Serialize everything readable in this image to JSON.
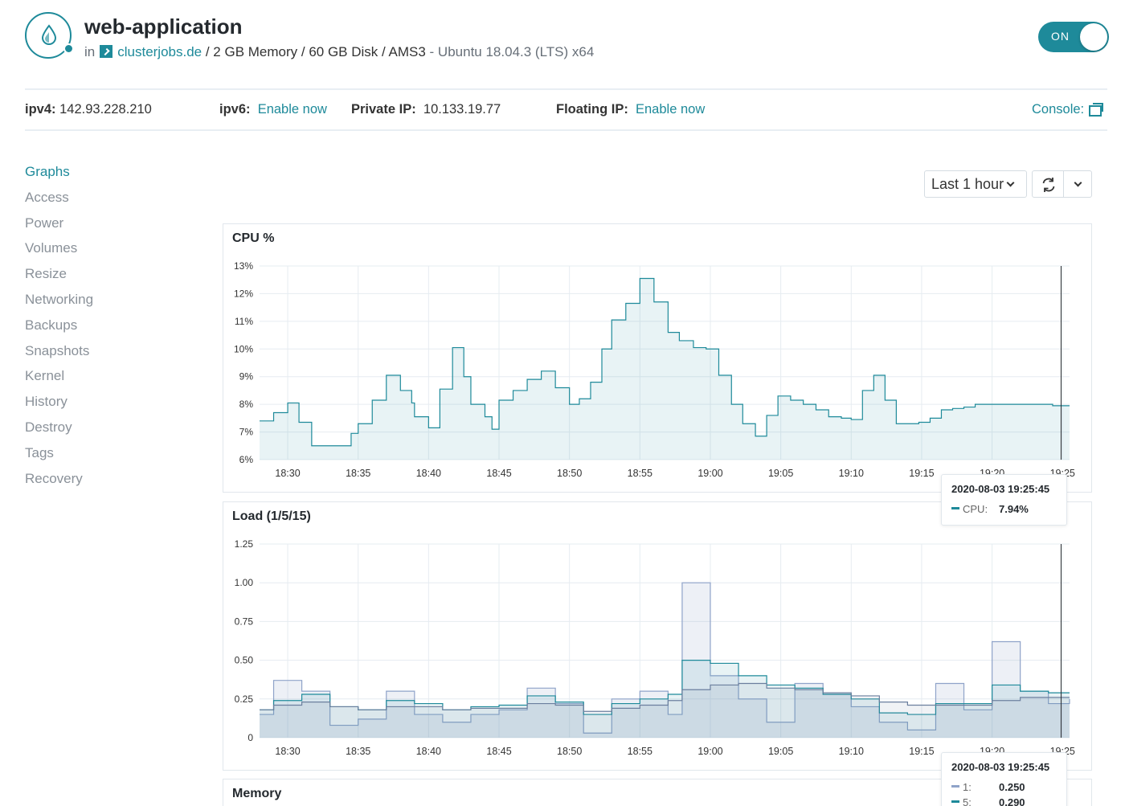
{
  "header": {
    "title": "web-application",
    "in_label": "in",
    "project_name": "clusterjobs.de",
    "specs": " / 2 GB Memory / 60 GB Disk / AMS3",
    "os": " - Ubuntu 18.04.3 (LTS) x64",
    "power_toggle_label": "ON",
    "accent_color": "#1e8a9a"
  },
  "ips": {
    "ipv4_label": "ipv4:",
    "ipv4_value": "142.93.228.210",
    "ipv6_label": "ipv6:",
    "ipv6_link": "Enable now",
    "private_label": "Private IP:",
    "private_value": "10.133.19.77",
    "floating_label": "Floating IP:",
    "floating_link": "Enable now",
    "console_label": "Console:"
  },
  "sidebar": {
    "items": [
      {
        "label": "Graphs",
        "active": true
      },
      {
        "label": "Access"
      },
      {
        "label": "Power"
      },
      {
        "label": "Volumes"
      },
      {
        "label": "Resize"
      },
      {
        "label": "Networking"
      },
      {
        "label": "Backups"
      },
      {
        "label": "Snapshots"
      },
      {
        "label": "Kernel"
      },
      {
        "label": "History"
      },
      {
        "label": "Destroy"
      },
      {
        "label": "Tags"
      },
      {
        "label": "Recovery"
      }
    ]
  },
  "toolbar": {
    "range_label": "Last 1 hour",
    "refresh_icon": "refresh-icon",
    "more_icon": "chevron-down-icon"
  },
  "chart_data": [
    {
      "type": "area",
      "title": "CPU %",
      "x_ticks": [
        "18:30",
        "18:35",
        "18:40",
        "18:45",
        "18:50",
        "18:55",
        "19:00",
        "19:05",
        "19:10",
        "19:15",
        "19:20",
        "19:25"
      ],
      "y_ticks": [
        "6%",
        "7%",
        "8%",
        "9%",
        "10%",
        "11%",
        "12%",
        "13%"
      ],
      "ylim": [
        6,
        13
      ],
      "x_start_min": 28.0,
      "x_end_min": 85.5,
      "grid": true,
      "cursor_min": 84.9,
      "series": [
        {
          "name": "CPU",
          "color": "#1e8a9a",
          "x": [
            28.0,
            29.0,
            30.0,
            30.8,
            31.7,
            32.0,
            34.5,
            35.0,
            36.0,
            37.0,
            38.0,
            38.8,
            39.0,
            40.0,
            40.8,
            41.7,
            42.5,
            43.0,
            44.0,
            44.5,
            45.0,
            46.0,
            47.0,
            48.0,
            49.0,
            50.0,
            50.7,
            51.5,
            52.3,
            53.0,
            54.0,
            55.0,
            56.0,
            57.0,
            57.8,
            58.8,
            59.7,
            60.6,
            61.5,
            62.3,
            63.2,
            64.0,
            64.8,
            65.7,
            66.6,
            67.5,
            68.4,
            69.3,
            70.0,
            70.8,
            71.6,
            72.4,
            73.2,
            74.0,
            74.8,
            75.6,
            76.4,
            77.2,
            78.0,
            78.8,
            79.6,
            80.4,
            81.2,
            82.0,
            82.8,
            83.6,
            84.3,
            85.0,
            85.5
          ],
          "y": [
            7.4,
            7.7,
            8.05,
            7.35,
            6.5,
            6.5,
            6.95,
            7.3,
            8.15,
            9.05,
            8.5,
            8.05,
            7.55,
            7.15,
            8.55,
            10.05,
            9.0,
            8.0,
            7.55,
            7.1,
            8.15,
            8.5,
            8.9,
            9.2,
            8.6,
            8.0,
            8.2,
            8.8,
            10.0,
            11.05,
            11.65,
            12.55,
            11.7,
            10.6,
            10.3,
            10.05,
            10.0,
            9.05,
            8.0,
            7.3,
            6.85,
            7.6,
            8.3,
            8.15,
            8.0,
            7.8,
            7.55,
            7.5,
            7.45,
            8.5,
            9.05,
            8.15,
            7.3,
            7.3,
            7.35,
            7.5,
            7.8,
            7.85,
            7.9,
            8.0,
            8.0,
            8.0,
            8.0,
            8.0,
            8.0,
            8.0,
            7.95,
            7.95,
            7.95
          ]
        }
      ]
    },
    {
      "type": "area",
      "title": "Load (1/5/15)",
      "x_ticks": [
        "18:30",
        "18:35",
        "18:40",
        "18:45",
        "18:50",
        "18:55",
        "19:00",
        "19:05",
        "19:10",
        "19:15",
        "19:20",
        "19:25"
      ],
      "y_ticks": [
        "0",
        "0.25",
        "0.50",
        "0.75",
        "1.00",
        "1.25"
      ],
      "ylim": [
        0,
        1.25
      ],
      "x_start_min": 28.0,
      "x_end_min": 85.5,
      "grid": true,
      "cursor_min": 84.9,
      "series": [
        {
          "name": "1",
          "color": "#8fa3c9",
          "x": [
            28.0,
            29.0,
            31.0,
            33.0,
            35.0,
            37.0,
            39.0,
            41.0,
            43.0,
            45.0,
            47.0,
            49.0,
            51.0,
            53.0,
            55.0,
            57.0,
            58.0,
            60.0,
            62.0,
            64.0,
            66.0,
            68.0,
            70.0,
            72.0,
            74.0,
            76.0,
            78.0,
            80.0,
            82.0,
            84.0,
            85.5
          ],
          "y": [
            0.15,
            0.37,
            0.3,
            0.08,
            0.12,
            0.3,
            0.15,
            0.1,
            0.15,
            0.18,
            0.32,
            0.22,
            0.03,
            0.25,
            0.3,
            0.15,
            1.0,
            0.4,
            0.25,
            0.1,
            0.35,
            0.28,
            0.2,
            0.1,
            0.05,
            0.35,
            0.18,
            0.62,
            0.3,
            0.22,
            0.25
          ]
        },
        {
          "name": "5",
          "color": "#1e8a9a",
          "x": [
            28.0,
            29.0,
            31.0,
            33.0,
            35.0,
            37.0,
            39.0,
            41.0,
            43.0,
            45.0,
            47.0,
            49.0,
            51.0,
            53.0,
            55.0,
            57.0,
            58.0,
            60.0,
            62.0,
            64.0,
            66.0,
            68.0,
            70.0,
            72.0,
            74.0,
            76.0,
            78.0,
            80.0,
            82.0,
            84.0,
            85.5
          ],
          "y": [
            0.18,
            0.24,
            0.28,
            0.2,
            0.18,
            0.24,
            0.22,
            0.18,
            0.2,
            0.21,
            0.27,
            0.23,
            0.15,
            0.22,
            0.25,
            0.28,
            0.5,
            0.48,
            0.4,
            0.34,
            0.32,
            0.28,
            0.25,
            0.16,
            0.15,
            0.22,
            0.22,
            0.34,
            0.3,
            0.29,
            0.29
          ]
        },
        {
          "name": "15",
          "color": "#6b7f9e",
          "x": [
            28.0,
            29.0,
            31.0,
            33.0,
            35.0,
            37.0,
            39.0,
            41.0,
            43.0,
            45.0,
            47.0,
            49.0,
            51.0,
            53.0,
            55.0,
            57.0,
            58.0,
            60.0,
            62.0,
            64.0,
            66.0,
            68.0,
            70.0,
            72.0,
            74.0,
            76.0,
            78.0,
            80.0,
            82.0,
            84.0,
            85.5
          ],
          "y": [
            0.18,
            0.21,
            0.23,
            0.2,
            0.18,
            0.2,
            0.2,
            0.18,
            0.19,
            0.19,
            0.22,
            0.21,
            0.17,
            0.19,
            0.21,
            0.24,
            0.31,
            0.34,
            0.35,
            0.32,
            0.31,
            0.29,
            0.27,
            0.23,
            0.21,
            0.21,
            0.21,
            0.24,
            0.26,
            0.26,
            0.26
          ]
        }
      ]
    }
  ],
  "memory_panel": {
    "title": "Memory"
  },
  "cpu_tooltip": {
    "time": "2020-08-03 19:25:45",
    "rows": [
      {
        "label": "CPU:",
        "value": "7.94%",
        "color": "#1e8a9a"
      }
    ]
  },
  "load_tooltip": {
    "time": "2020-08-03 19:25:45",
    "rows": [
      {
        "label": "1:",
        "value": "0.250",
        "color": "#8fa3c9"
      },
      {
        "label": "5:",
        "value": "0.290",
        "color": "#1e8a9a"
      }
    ]
  }
}
